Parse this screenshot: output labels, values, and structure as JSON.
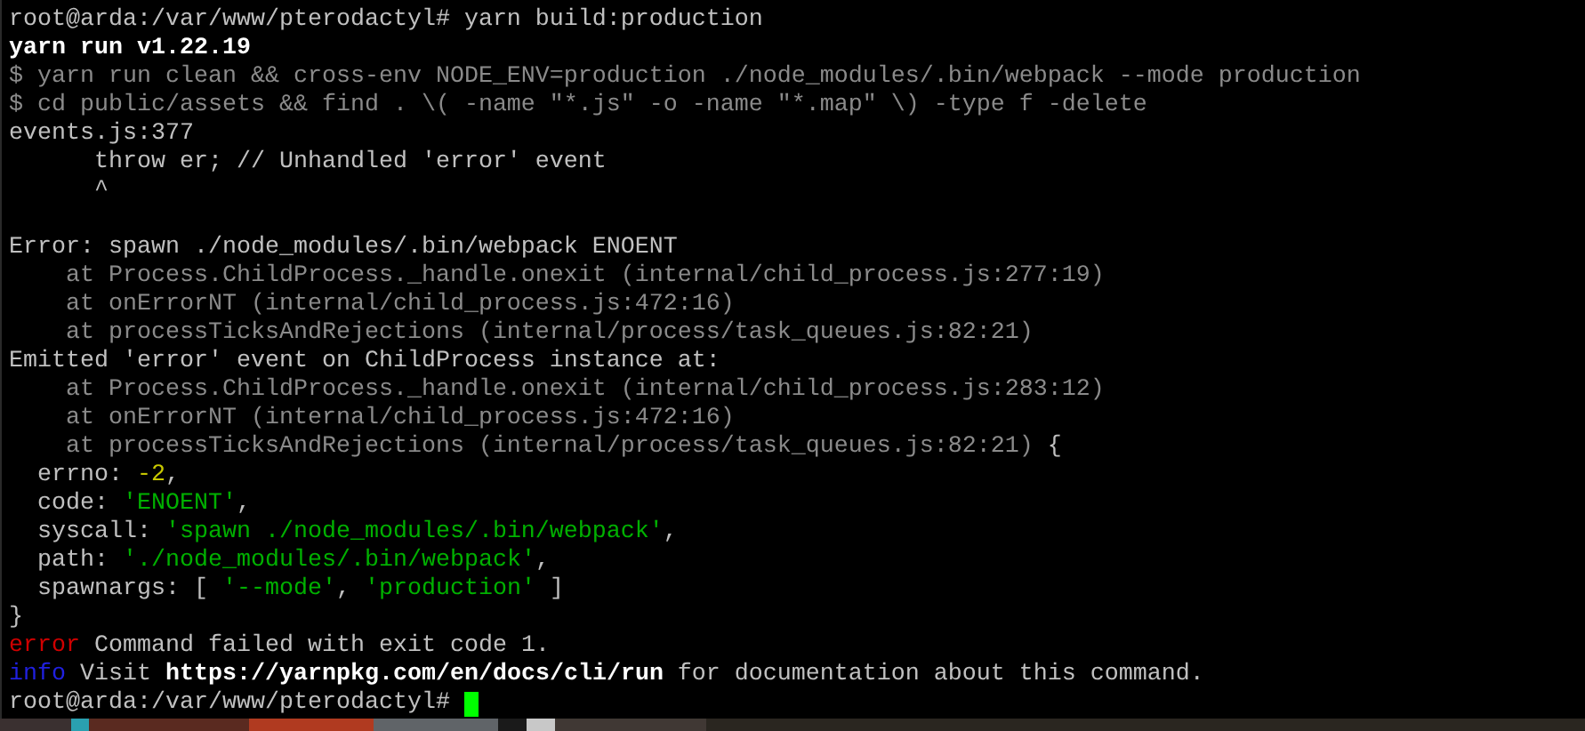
{
  "terminal": {
    "lines": [
      {
        "kind": "text",
        "segments": [
          {
            "text": "root@arda:/var/www/pterodactyl# yarn build:production",
            "kind": "plain"
          }
        ]
      },
      {
        "kind": "text",
        "segments": [
          {
            "text": "yarn run v1.22.19",
            "kind": "bright"
          }
        ]
      },
      {
        "kind": "text",
        "segments": [
          {
            "text": "$ yarn run clean && cross-env NODE_ENV=production ./node_modules/.bin/webpack --mode production",
            "kind": "dim"
          }
        ]
      },
      {
        "kind": "text",
        "segments": [
          {
            "text": "$ cd public/assets && find . \\( -name \"*.js\" -o -name \"*.map\" \\) -type f -delete",
            "kind": "dim"
          }
        ]
      },
      {
        "kind": "text",
        "segments": [
          {
            "text": "events.js:377",
            "kind": "plain"
          }
        ]
      },
      {
        "kind": "text",
        "segments": [
          {
            "text": "      throw er; // Unhandled 'error' event",
            "kind": "plain"
          }
        ]
      },
      {
        "kind": "text",
        "segments": [
          {
            "text": "      ^",
            "kind": "plain"
          }
        ]
      },
      {
        "kind": "blank"
      },
      {
        "kind": "text",
        "segments": [
          {
            "text": "Error: spawn ./node_modules/.bin/webpack ENOENT",
            "kind": "plain"
          }
        ]
      },
      {
        "kind": "text",
        "segments": [
          {
            "text": "    at Process.ChildProcess._handle.onexit (internal/child_process.js:277:19)",
            "kind": "dim"
          }
        ]
      },
      {
        "kind": "text",
        "segments": [
          {
            "text": "    at onErrorNT (internal/child_process.js:472:16)",
            "kind": "dim"
          }
        ]
      },
      {
        "kind": "text",
        "segments": [
          {
            "text": "    at processTicksAndRejections (internal/process/task_queues.js:82:21)",
            "kind": "dim"
          }
        ]
      },
      {
        "kind": "text",
        "segments": [
          {
            "text": "Emitted 'error' event on ChildProcess instance at:",
            "kind": "plain"
          }
        ]
      },
      {
        "kind": "text",
        "segments": [
          {
            "text": "    at Process.ChildProcess._handle.onexit (internal/child_process.js:283:12)",
            "kind": "dim"
          }
        ]
      },
      {
        "kind": "text",
        "segments": [
          {
            "text": "    at onErrorNT (internal/child_process.js:472:16)",
            "kind": "dim"
          }
        ]
      },
      {
        "kind": "text",
        "segments": [
          {
            "text": "    at processTicksAndRejections (internal/process/task_queues.js:82:21)",
            "kind": "dim"
          },
          {
            "text": " {",
            "kind": "plain"
          }
        ]
      },
      {
        "kind": "text",
        "segments": [
          {
            "text": "  errno:",
            "kind": "plain"
          },
          {
            "text": " -2",
            "kind": "number"
          },
          {
            "text": ",",
            "kind": "plain"
          }
        ]
      },
      {
        "kind": "text",
        "segments": [
          {
            "text": "  code:",
            "kind": "plain"
          },
          {
            "text": " 'ENOENT'",
            "kind": "string"
          },
          {
            "text": ",",
            "kind": "plain"
          }
        ]
      },
      {
        "kind": "text",
        "segments": [
          {
            "text": "  syscall:",
            "kind": "plain"
          },
          {
            "text": " 'spawn ./node_modules/.bin/webpack'",
            "kind": "string"
          },
          {
            "text": ",",
            "kind": "plain"
          }
        ]
      },
      {
        "kind": "text",
        "segments": [
          {
            "text": "  path:",
            "kind": "plain"
          },
          {
            "text": " './node_modules/.bin/webpack'",
            "kind": "string"
          },
          {
            "text": ",",
            "kind": "plain"
          }
        ]
      },
      {
        "kind": "text",
        "segments": [
          {
            "text": "  spawnargs: [",
            "kind": "plain"
          },
          {
            "text": " '--mode'",
            "kind": "string"
          },
          {
            "text": ",",
            "kind": "plain"
          },
          {
            "text": " 'production'",
            "kind": "string"
          },
          {
            "text": " ]",
            "kind": "plain"
          }
        ]
      },
      {
        "kind": "text",
        "segments": [
          {
            "text": "}",
            "kind": "plain"
          }
        ]
      },
      {
        "kind": "text",
        "segments": [
          {
            "text": "error",
            "kind": "error"
          },
          {
            "text": " Command failed with exit code 1.",
            "kind": "plain"
          }
        ]
      },
      {
        "kind": "text",
        "segments": [
          {
            "text": "info",
            "kind": "info"
          },
          {
            "text": " Visit ",
            "kind": "plain"
          },
          {
            "text": "https://yarnpkg.com/en/docs/cli/run",
            "kind": "bright"
          },
          {
            "text": " for documentation about this command.",
            "kind": "plain"
          }
        ]
      },
      {
        "kind": "text",
        "segments": [
          {
            "text": "root@arda:/var/www/pterodactyl# ",
            "kind": "plain"
          }
        ],
        "cursor": true
      }
    ]
  }
}
